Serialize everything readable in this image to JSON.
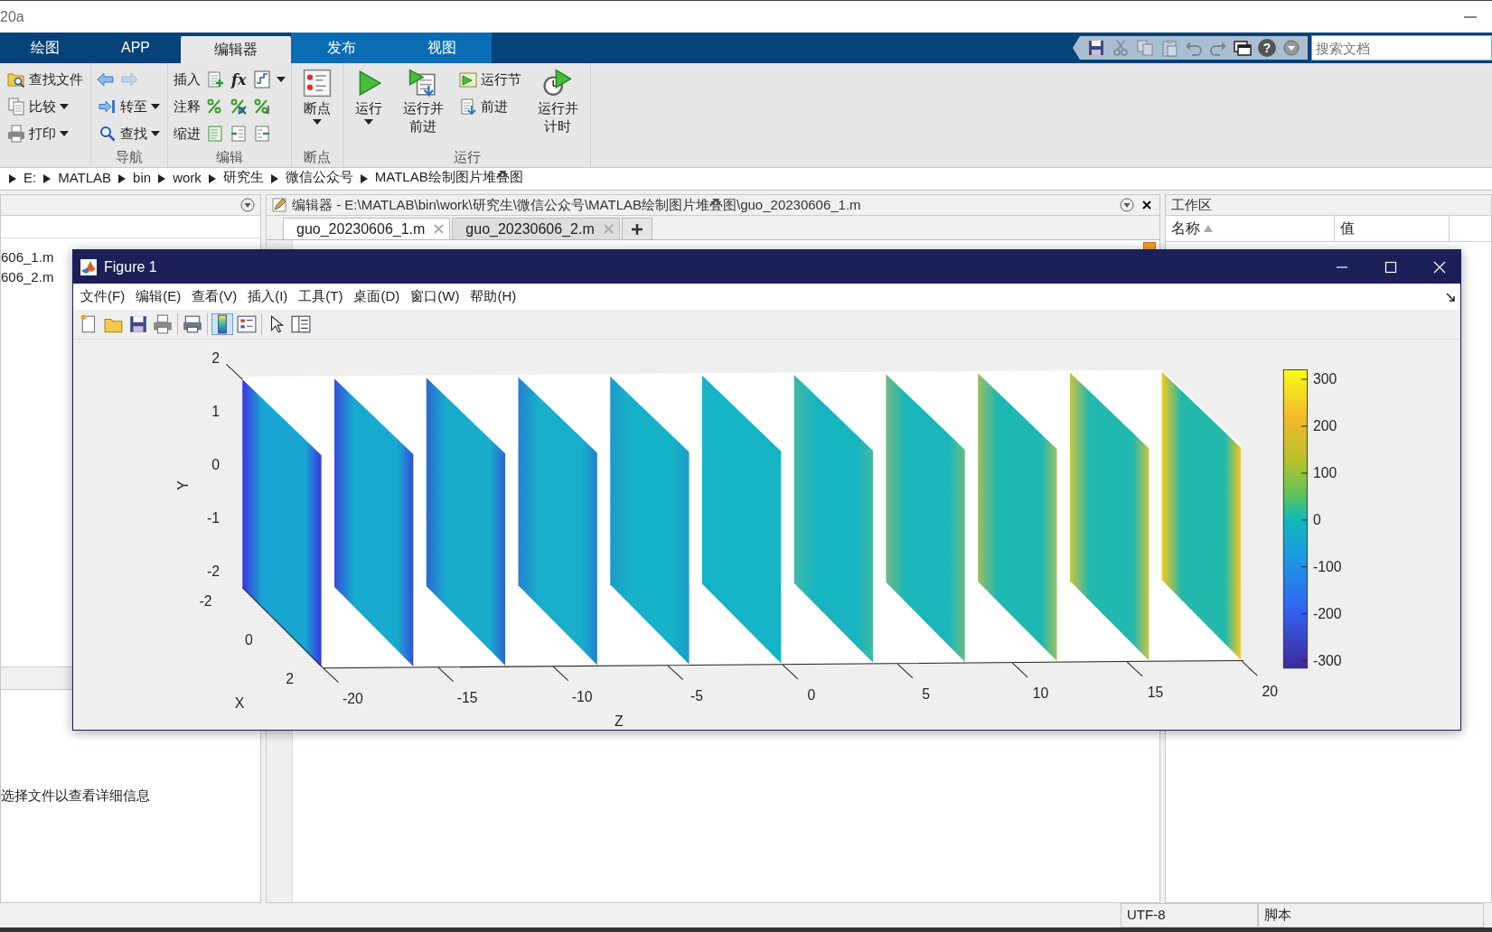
{
  "app": {
    "title": "20a"
  },
  "ribbon_tabs": [
    {
      "label": "绘图",
      "selected": false,
      "contextual": false
    },
    {
      "label": "APP",
      "selected": false,
      "contextual": false
    },
    {
      "label": "编辑器",
      "selected": true,
      "contextual": true
    },
    {
      "label": "发布",
      "selected": false,
      "contextual": true
    },
    {
      "label": "视图",
      "selected": false,
      "contextual": true
    }
  ],
  "quick_access": [
    {
      "kind": "save",
      "disabled": false
    },
    {
      "kind": "cut",
      "disabled": true
    },
    {
      "kind": "copy",
      "disabled": true
    },
    {
      "kind": "paste",
      "disabled": true
    },
    {
      "kind": "undo",
      "disabled": true
    },
    {
      "kind": "redo",
      "disabled": true
    },
    {
      "kind": "windows",
      "disabled": false
    },
    {
      "kind": "help",
      "label": "?",
      "disabled": false
    },
    {
      "kind": "menu",
      "disabled": false
    }
  ],
  "search": {
    "placeholder": "搜索文档"
  },
  "ribbon_groups": [
    {
      "columns": [
        {
          "rows": [
            [
              {
                "kind": "find-files",
                "label": "查找文件"
              }
            ],
            [
              {
                "kind": "compare",
                "label": "比较",
                "dropdown": true
              }
            ],
            [
              {
                "kind": "print",
                "label": "打印",
                "dropdown": true
              }
            ]
          ]
        }
      ]
    },
    {
      "label": "导航",
      "columns": [
        {
          "rows": [
            [
              {
                "kind": "back",
                "disabled": false
              },
              {
                "kind": "forward",
                "disabled": true
              }
            ],
            [
              {
                "kind": "goto",
                "label": "转至",
                "dropdown": true
              }
            ],
            [
              {
                "kind": "search",
                "label": "查找",
                "dropdown": true
              }
            ]
          ]
        }
      ]
    },
    {
      "label": "编辑",
      "columns": [
        {
          "rows": [
            [
              {
                "kind": "label",
                "label": "插入"
              },
              {
                "kind": "insert-section"
              },
              {
                "kind": "function",
                "label": "fx"
              },
              {
                "kind": "format",
                "dropdown": true
              }
            ],
            [
              {
                "kind": "label",
                "label": "注释"
              },
              {
                "kind": "comment"
              },
              {
                "kind": "uncomment"
              },
              {
                "kind": "wrap"
              }
            ],
            [
              {
                "kind": "label",
                "label": "缩进"
              },
              {
                "kind": "smart-indent"
              },
              {
                "kind": "indent"
              },
              {
                "kind": "outdent"
              }
            ]
          ]
        }
      ]
    },
    {
      "label": "断点",
      "columns": [
        {
          "kind": "breakpoints",
          "label": "断点",
          "dropdown": true
        }
      ]
    },
    {
      "label": "运行",
      "columns": [
        {
          "kind": "run",
          "label": "运行",
          "dropdown": true
        },
        {
          "kind": "run-advance",
          "label": "运行并前进"
        },
        {
          "rows": [
            [
              {
                "kind": "run-section",
                "label": "运行节"
              }
            ],
            [
              {
                "kind": "advance",
                "label": "前进"
              }
            ]
          ]
        },
        {
          "kind": "run-time",
          "label": "运行并计时"
        }
      ]
    }
  ],
  "address": [
    "E:",
    "MATLAB",
    "bin",
    "work",
    "研究生",
    "微信公众号",
    "MATLAB绘制图片堆叠图"
  ],
  "current_folder": {
    "files": [
      "606_1.m",
      "606_2.m"
    ],
    "details_hint": "选择文件以查看详细信息"
  },
  "editor": {
    "title": "编辑器 - E:\\MATLAB\\bin\\work\\研究生\\微信公众号\\MATLAB绘制图片堆叠图\\guo_20230606_1.m",
    "tabs": [
      {
        "label": "guo_20230606_1.m",
        "selected": true
      },
      {
        "label": "guo_20230606_2.m",
        "selected": false
      }
    ]
  },
  "workspace": {
    "title": "工作区",
    "columns": [
      {
        "label": "名称",
        "sorted": true
      },
      {
        "label": "值",
        "sorted": false
      }
    ]
  },
  "status_bar": [
    "UTF-8",
    "脚本"
  ],
  "figure": {
    "title": "Figure 1",
    "menu": [
      "文件(F)",
      "编辑(E)",
      "查看(V)",
      "插入(I)",
      "工具(T)",
      "桌面(D)",
      "窗口(W)",
      "帮助(H)"
    ],
    "toolbar": [
      [
        {
          "kind": "new",
          "selected": false
        },
        {
          "kind": "open",
          "selected": false
        },
        {
          "kind": "save",
          "selected": false
        },
        {
          "kind": "print",
          "selected": false
        }
      ],
      [
        {
          "kind": "link",
          "selected": false
        }
      ],
      [
        {
          "kind": "colorbar",
          "selected": true
        },
        {
          "kind": "legend",
          "selected": false
        }
      ],
      [
        {
          "kind": "pointer",
          "selected": false
        },
        {
          "kind": "property",
          "selected": false
        }
      ]
    ],
    "axes": {
      "y_label": "Y",
      "y_ticks": [
        "2",
        "1",
        "0",
        "-1",
        "-2"
      ],
      "x_label": "X",
      "x_ticks": [
        "-2",
        "0",
        "2"
      ],
      "z_label": "Z",
      "z_ticks": [
        "-20",
        "-15",
        "-10",
        "-5",
        "0",
        "5",
        "10",
        "15",
        "20"
      ]
    },
    "colorbar": {
      "ticks": [
        "300",
        "200",
        "100",
        "0",
        "-100",
        "-200",
        "-300"
      ]
    }
  }
}
